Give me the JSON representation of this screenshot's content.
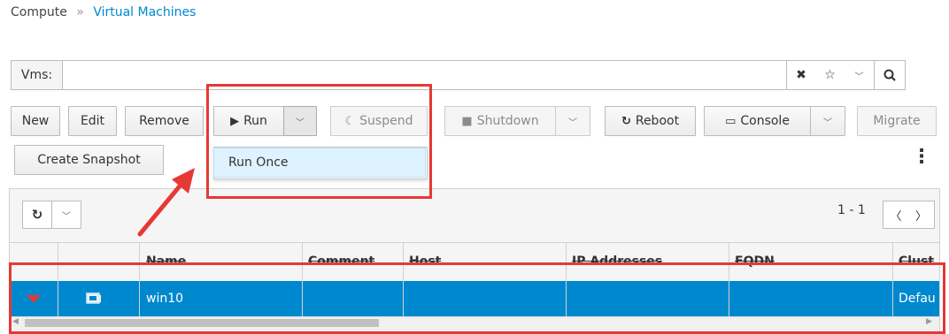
{
  "breadcrumb": {
    "root": "Compute",
    "separator": "»",
    "current": "Virtual Machines"
  },
  "search": {
    "label": "Vms:",
    "value": "",
    "placeholder": ""
  },
  "toolbar": {
    "new_label": "New",
    "edit_label": "Edit",
    "remove_label": "Remove",
    "run_label": "Run",
    "suspend_label": "Suspend",
    "shutdown_label": "Shutdown",
    "reboot_label": "Reboot",
    "console_label": "Console",
    "migrate_label": "Migrate",
    "create_snapshot_label": "Create Snapshot",
    "kebab": "⋮"
  },
  "run_menu": {
    "items": [
      {
        "label": "Run Once"
      }
    ]
  },
  "pagination": {
    "range": "1 - 1"
  },
  "table": {
    "columns": [
      "Name",
      "Comment",
      "Host",
      "IP Addresses",
      "FQDN",
      "Clust"
    ],
    "rows": [
      {
        "name": "win10",
        "comment": "",
        "host": "",
        "ip": "",
        "fqdn": "",
        "cluster": "Defau"
      }
    ]
  },
  "colors": {
    "accent": "#0088ce",
    "selection": "#0088ce",
    "highlight": "#e53935",
    "menu_hover": "#def3ff"
  }
}
